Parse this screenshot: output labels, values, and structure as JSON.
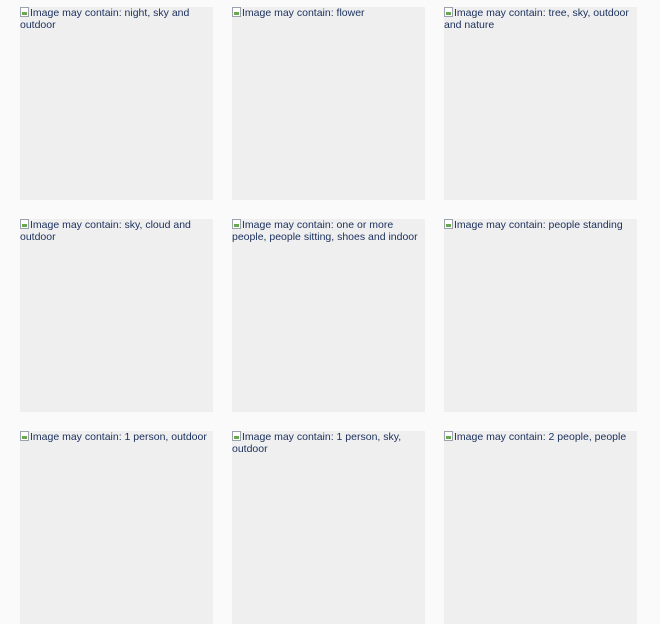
{
  "images": [
    {
      "alt": "Image may contain: night, sky and outdoor"
    },
    {
      "alt": "Image may contain: flower"
    },
    {
      "alt": "Image may contain: tree, sky, outdoor and nature"
    },
    {
      "alt": "Image may contain: sky, cloud and outdoor"
    },
    {
      "alt": "Image may contain: one or more people, people sitting, shoes and indoor"
    },
    {
      "alt": "Image may contain: people standing"
    },
    {
      "alt": "Image may contain: 1 person, outdoor"
    },
    {
      "alt": "Image may contain: 1 person, sky, outdoor"
    },
    {
      "alt": "Image may contain: 2 people, people"
    }
  ]
}
